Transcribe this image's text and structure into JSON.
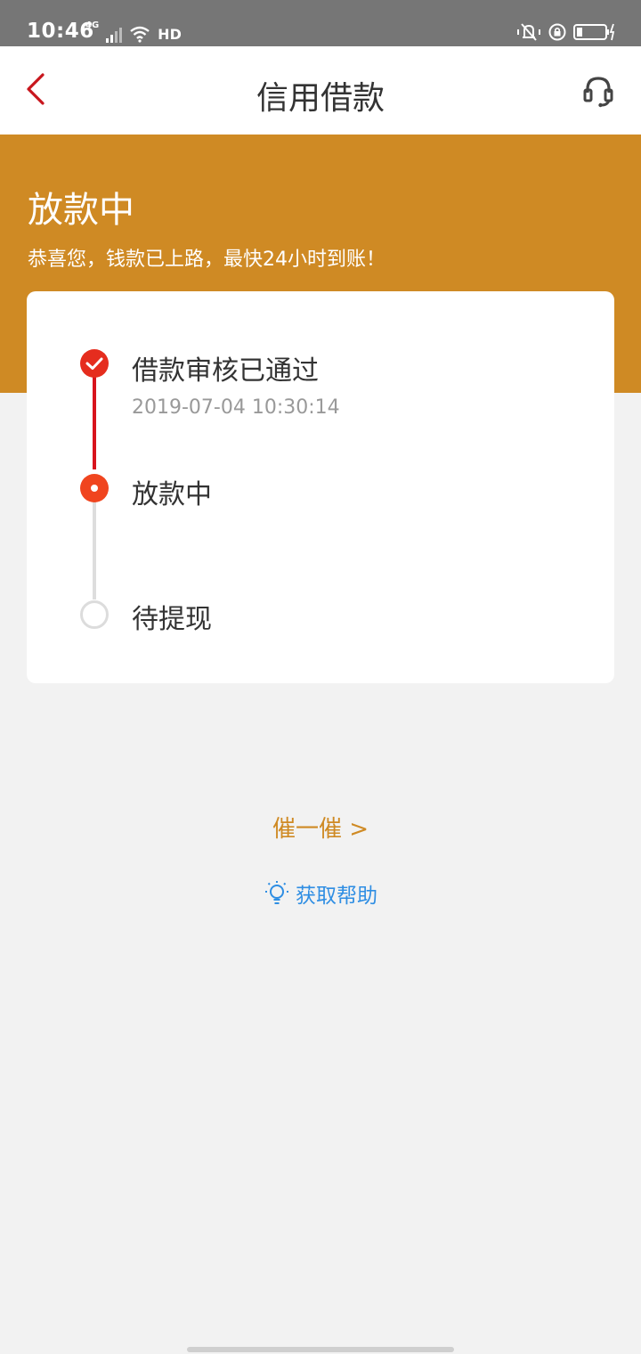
{
  "status_bar": {
    "time": "10:46",
    "network": "4G",
    "hd": "HD"
  },
  "nav": {
    "title": "信用借款"
  },
  "banner": {
    "title": "放款中",
    "subtitle": "恭喜您，钱款已上路，最快24小时到账！"
  },
  "timeline": {
    "steps": [
      {
        "label": "借款审核已通过",
        "time": "2019-07-04 10:30:14",
        "state": "done"
      },
      {
        "label": "放款中",
        "state": "current"
      },
      {
        "label": "待提现",
        "state": "pending"
      }
    ]
  },
  "actions": {
    "urge": "催一催 >",
    "help": "获取帮助"
  },
  "colors": {
    "banner": "#cf8a24",
    "accent_red": "#d8131d",
    "link_blue": "#2f8ee3",
    "urge_orange": "#cf8a24"
  },
  "icons": [
    "back-arrow-icon",
    "headset-icon",
    "check-icon",
    "lightbulb-icon",
    "wifi-icon",
    "signal-icon",
    "battery-icon",
    "mute-icon",
    "lock-icon"
  ]
}
